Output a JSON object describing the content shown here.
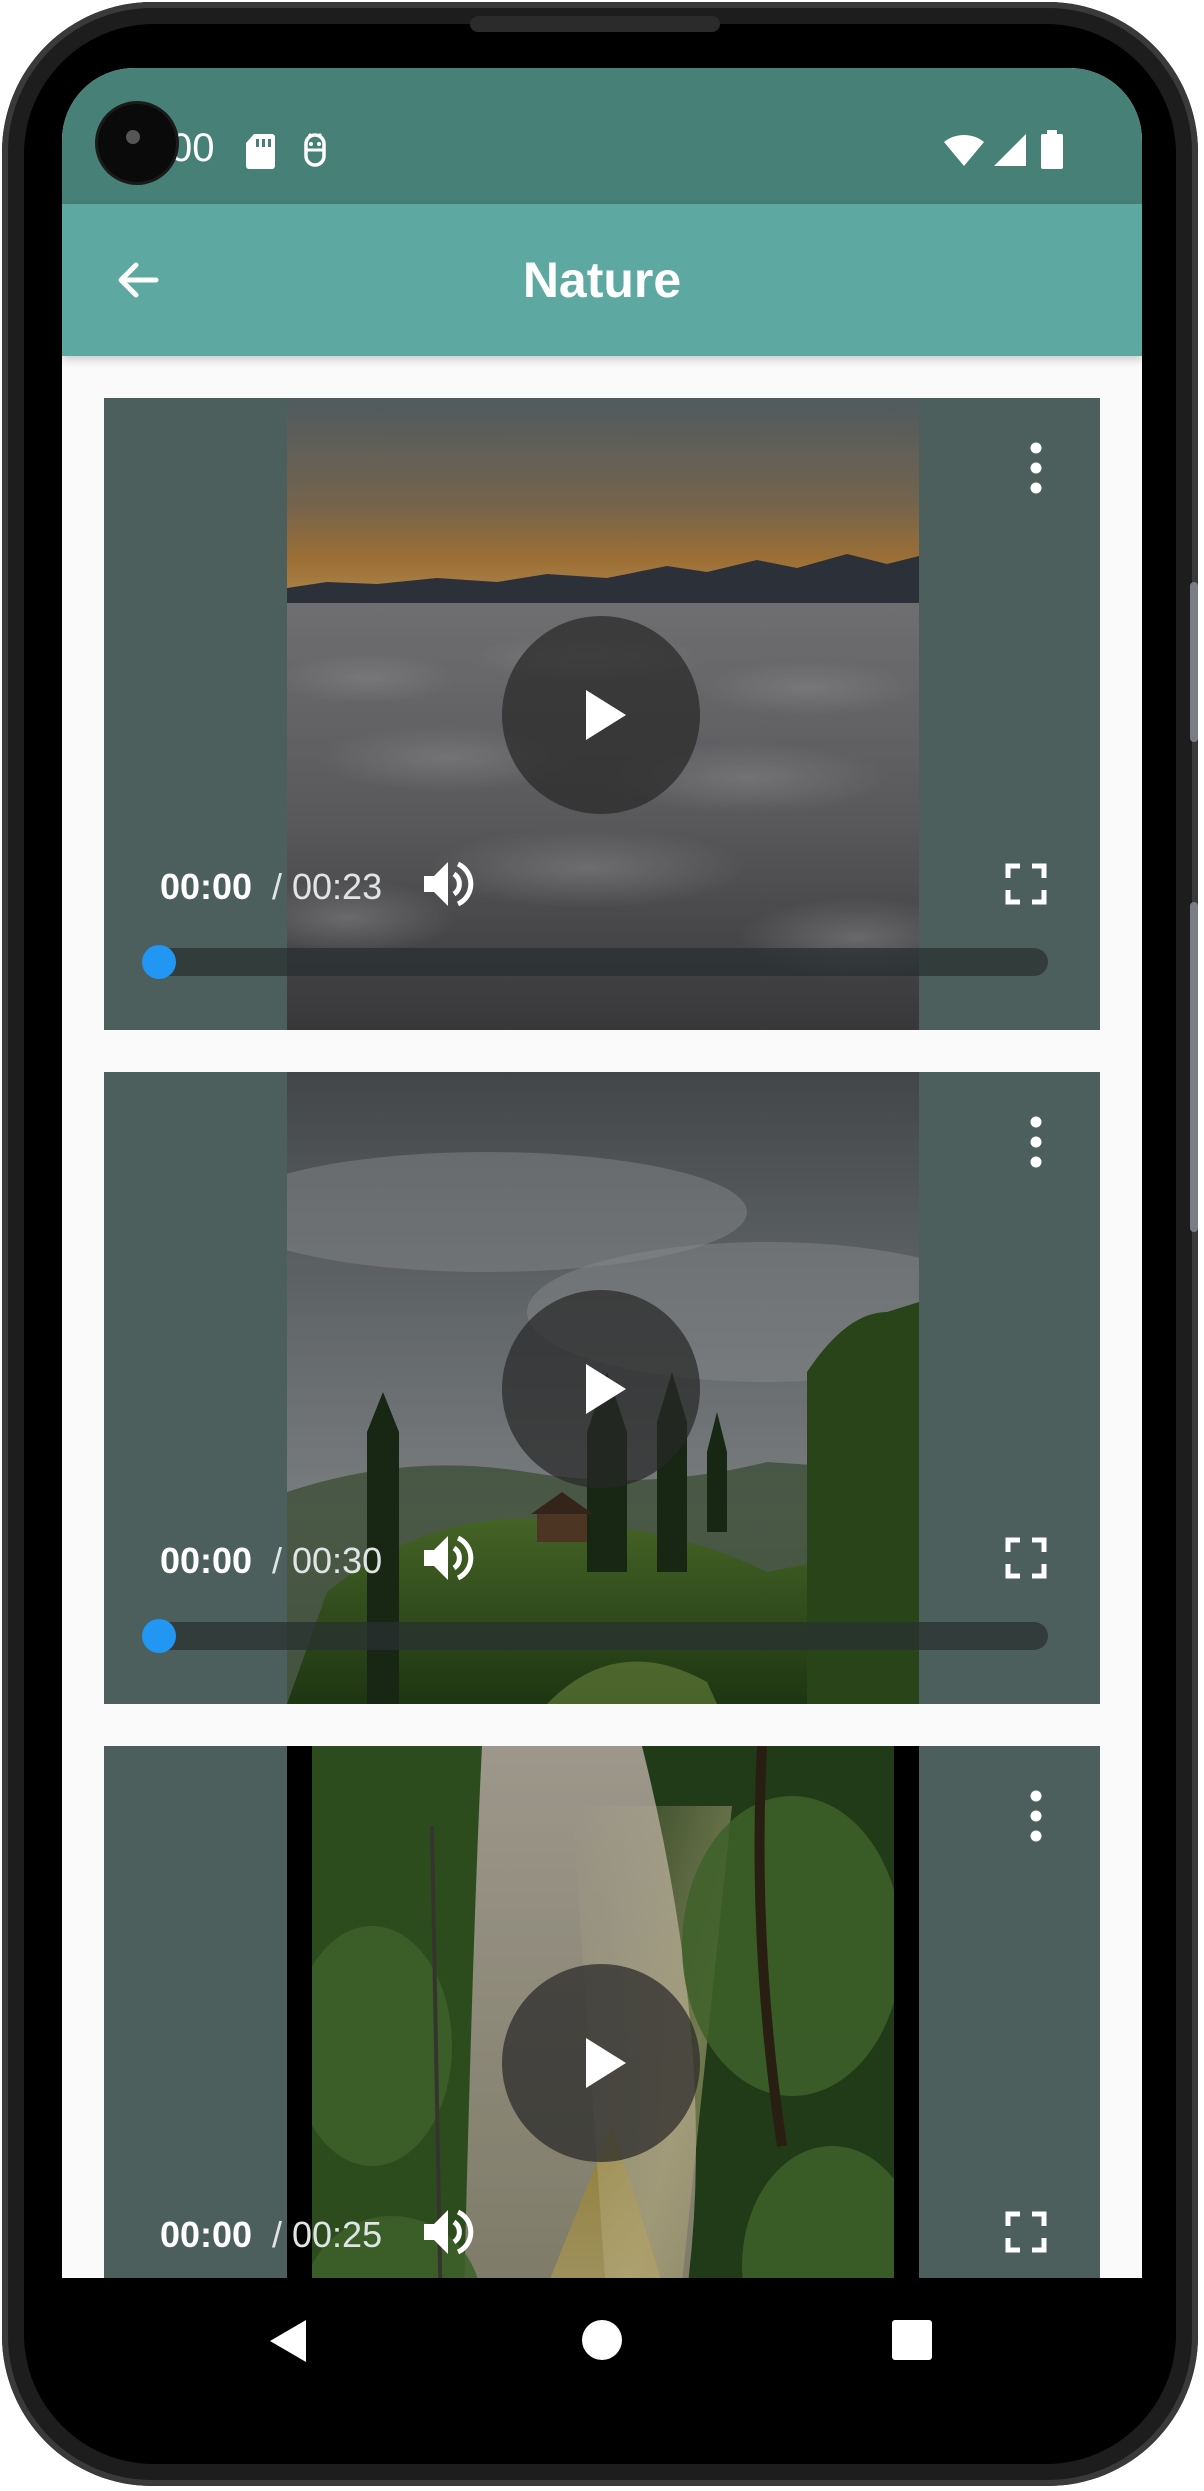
{
  "status_bar": {
    "time": "00",
    "icons": [
      "sd-card-icon",
      "android-debug-icon",
      "wifi-icon",
      "signal-icon",
      "battery-icon"
    ]
  },
  "app_bar": {
    "title": "Nature",
    "back_icon": "arrow-left-icon"
  },
  "videos": [
    {
      "current_time": "00:00",
      "total_time": "/ 00:23",
      "progress": 0,
      "theme": "clouds-sunset"
    },
    {
      "current_time": "00:00",
      "total_time": "/ 00:30",
      "progress": 0,
      "theme": "misty-forest-hill"
    },
    {
      "current_time": "00:00",
      "total_time": "/ 00:25",
      "progress": 0,
      "theme": "sunlit-forest-road"
    }
  ],
  "nav_bar": {
    "buttons": [
      "back-triangle-icon",
      "home-circle-icon",
      "recents-square-icon"
    ]
  },
  "colors": {
    "status_bar": "#468077",
    "app_bar": "#5da8a0",
    "card_background": "#6a8480",
    "progress_accent": "#2196f3"
  }
}
